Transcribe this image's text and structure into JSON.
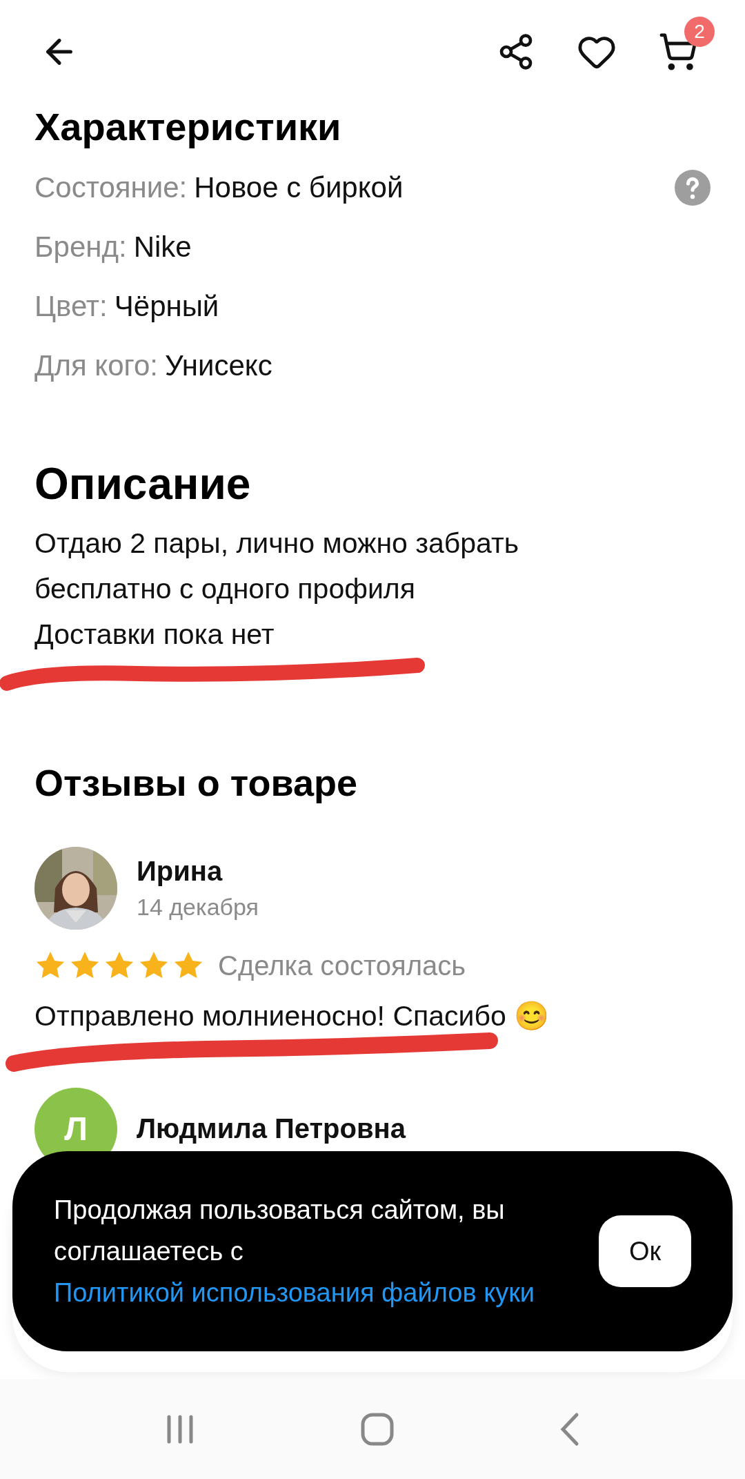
{
  "header": {
    "cart_badge": "2"
  },
  "specs": {
    "title": "Характеристики",
    "rows": [
      {
        "label": "Состояние:",
        "value": "Новое с биркой",
        "help": true
      },
      {
        "label": "Бренд:",
        "value": "Nike",
        "help": false
      },
      {
        "label": "Цвет:",
        "value": "Чёрный",
        "help": false
      },
      {
        "label": "Для кого:",
        "value": "Унисекс",
        "help": false
      }
    ]
  },
  "description": {
    "title": "Описание",
    "lines": [
      "Отдаю 2 пары, лично можно забрать",
      "бесплатно с одного профиля",
      "Доставки пока нет"
    ]
  },
  "reviews": {
    "title": "Отзывы о товаре",
    "items": [
      {
        "author": "Ирина",
        "date": "14 декабря",
        "stars": 5,
        "status": "Сделка состоялась",
        "text": "Отправлено молниеносно! Спасибо 😊"
      },
      {
        "author": "Людмила Петровна",
        "avatar": {
          "kind": "initial",
          "letter": "Л",
          "color": "#8bc34a"
        }
      }
    ]
  },
  "cookie_banner": {
    "text": "Продолжая пользоваться сайтом, вы соглашаетесь с",
    "link": "Политикой использования файлов куки",
    "button": "Ок"
  }
}
